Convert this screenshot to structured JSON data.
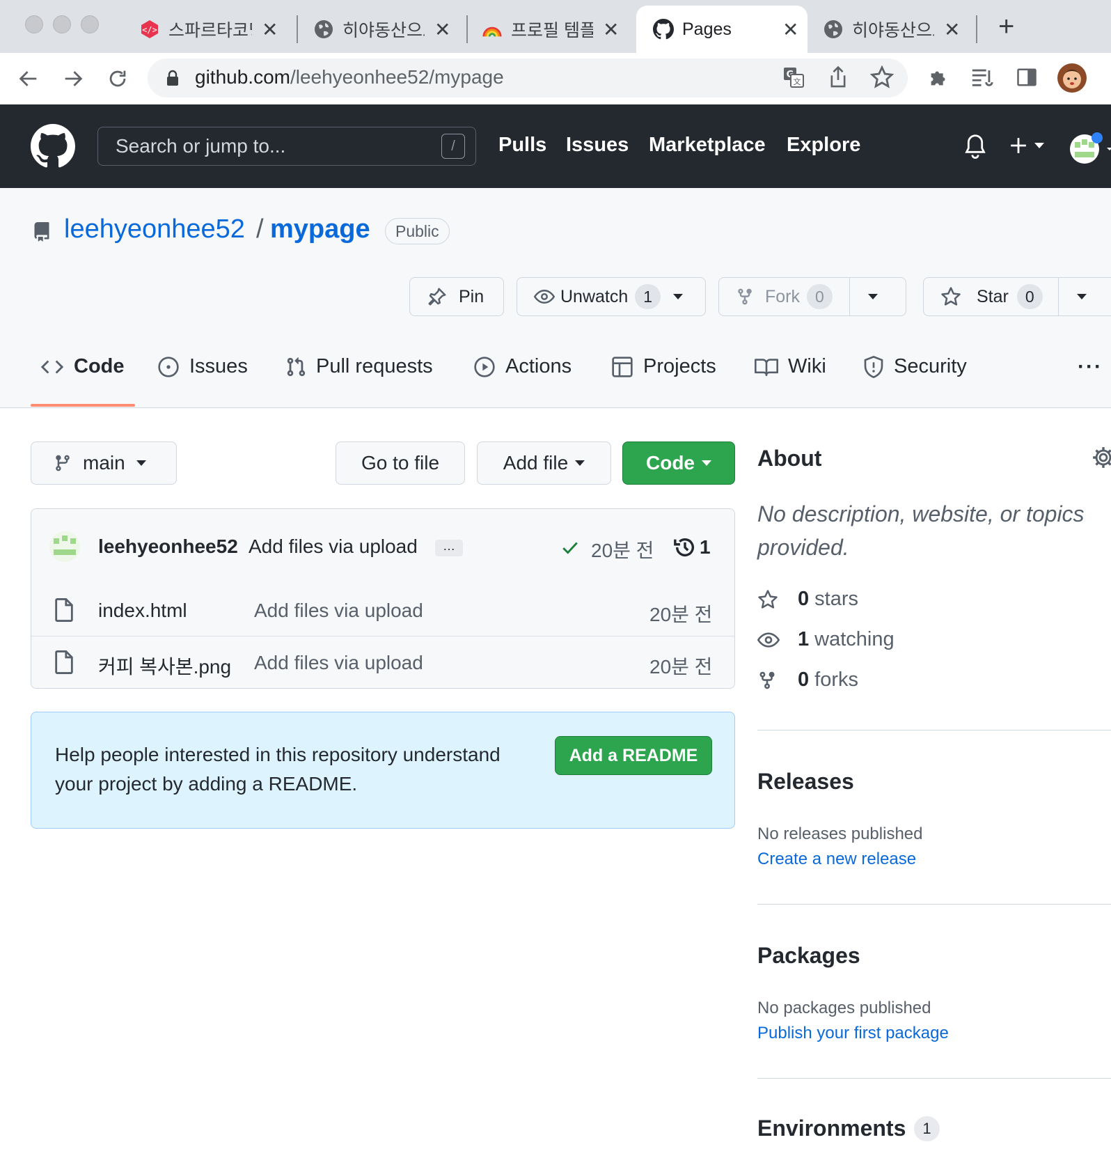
{
  "browser": {
    "tabs": [
      {
        "title": "스파르타코딩",
        "icon": "spartacoding-favicon",
        "active": false
      },
      {
        "title": "히야동산으로",
        "icon": "globe-icon",
        "active": false
      },
      {
        "title": "프로필 템플릿",
        "icon": "rainbow-favicon",
        "active": false
      },
      {
        "title": "Pages",
        "icon": "github-favicon",
        "active": true
      },
      {
        "title": "히야동산으로",
        "icon": "globe-icon",
        "active": false
      }
    ],
    "new_tab_symbol": "+",
    "close_symbol": "✕",
    "url_host": "github.com",
    "url_path": "/leehyeonhee52/mypage"
  },
  "header": {
    "search_placeholder": "Search or jump to...",
    "search_shortcut": "/",
    "nav": [
      "Pulls",
      "Issues",
      "Marketplace",
      "Explore"
    ]
  },
  "repo": {
    "owner": "leehyeonhee52",
    "separator": "/",
    "name": "mypage",
    "visibility": "Public",
    "actions": {
      "pin": "Pin",
      "watch": "Unwatch",
      "watch_count": "1",
      "fork": "Fork",
      "fork_count": "0",
      "star": "Star",
      "star_count": "0"
    },
    "tabs": [
      "Code",
      "Issues",
      "Pull requests",
      "Actions",
      "Projects",
      "Wiki",
      "Security"
    ],
    "more_symbol": "···"
  },
  "main": {
    "branch": "main",
    "go_to_file": "Go to file",
    "add_file": "Add file",
    "code_button": "Code",
    "commit": {
      "author": "leehyeonhee52",
      "message": "Add files via upload",
      "ellipsis": "…",
      "time": "20분 전",
      "count": "1"
    },
    "files": [
      {
        "name": "index.html",
        "message": "Add files via upload",
        "time": "20분 전"
      },
      {
        "name": "커피 복사본.png",
        "message": "Add files via upload",
        "time": "20분 전"
      }
    ],
    "readme_prompt": "Help people interested in this repository understand your project by adding a README.",
    "readme_button": "Add a README"
  },
  "sidebar": {
    "about_title": "About",
    "about_desc": "No description, website, or topics provided.",
    "stars_count": "0",
    "stars_label": "stars",
    "watching_count": "1",
    "watching_label": "watching",
    "forks_count": "0",
    "forks_label": "forks",
    "releases_title": "Releases",
    "releases_none": "No releases published",
    "releases_link": "Create a new release",
    "packages_title": "Packages",
    "packages_none": "No packages published",
    "packages_link": "Publish your first package",
    "environments_title": "Environments",
    "environments_count": "1"
  },
  "colors": {
    "header_bg": "#24292f",
    "link_blue": "#0969da",
    "primary_green": "#2da44e",
    "tab_underline": "#fd8c73",
    "readme_bg": "#ddf4ff"
  }
}
